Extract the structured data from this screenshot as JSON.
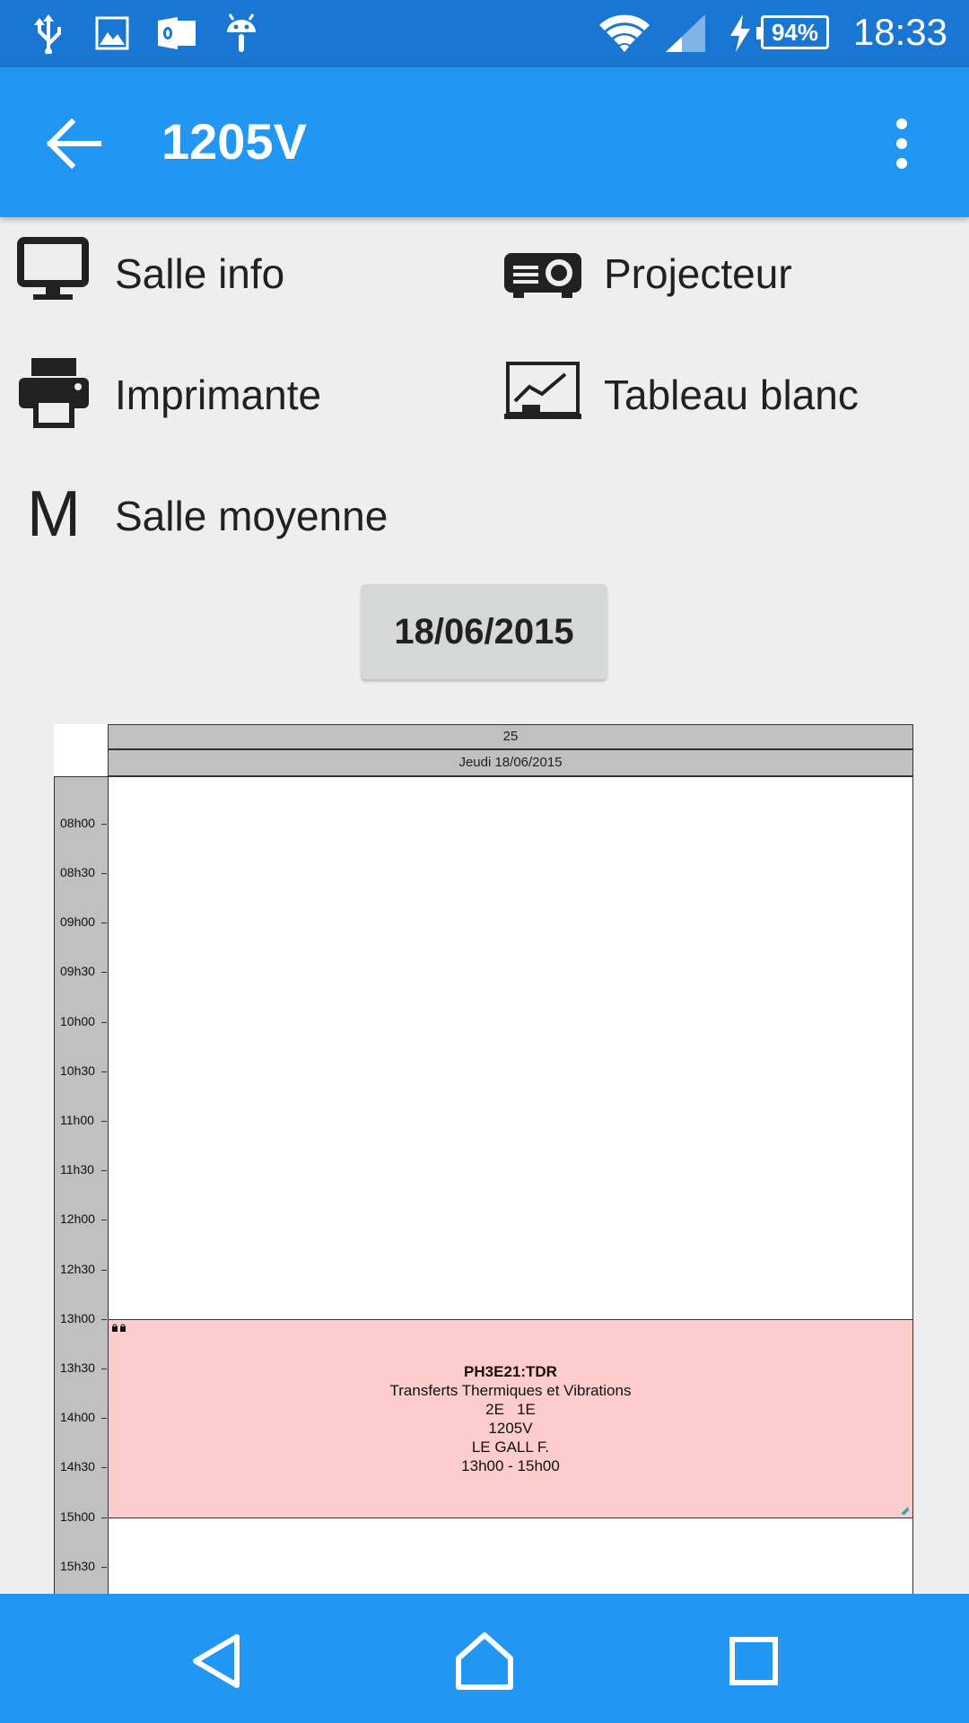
{
  "status_bar": {
    "icons": [
      "usb-icon",
      "image-icon",
      "outlook-icon",
      "android-icon",
      "wifi-icon",
      "signal-icon",
      "charging-icon"
    ],
    "battery": "94%",
    "time": "18:33"
  },
  "app_bar": {
    "title": "1205V",
    "back_icon": "arrow-back-icon",
    "menu_icon": "more-vert-icon"
  },
  "features": [
    {
      "label": "Salle info",
      "icon": "monitor-icon"
    },
    {
      "label": "Projecteur",
      "icon": "projector-icon"
    },
    {
      "label": "Imprimante",
      "icon": "printer-icon"
    },
    {
      "label": "Tableau blanc",
      "icon": "whiteboard-icon"
    },
    {
      "label": "Salle moyenne",
      "icon": "letter-m-icon",
      "letter": "M"
    }
  ],
  "date_button": "18/06/2015",
  "timetable": {
    "week": "25",
    "day": "Jeudi 18/06/2015",
    "times": [
      "08h00",
      "08h30",
      "09h00",
      "09h30",
      "10h00",
      "10h30",
      "11h00",
      "11h30",
      "12h00",
      "12h30",
      "13h00",
      "13h30",
      "14h00",
      "14h30",
      "15h00",
      "15h30"
    ],
    "event": {
      "code": "PH3E21:TDR",
      "title": "Transferts Thermiques et Vibrations",
      "groups": "2E   1E",
      "room": "1205V",
      "teacher": "LE GALL F.",
      "hours": "13h00 - 15h00",
      "color": "#fdcccc"
    }
  },
  "nav_bar": {
    "buttons": [
      "back-nav-icon",
      "home-nav-icon",
      "recents-nav-icon"
    ]
  },
  "colors": {
    "status_bar": "#1976d2",
    "app_bar": "#2196f3",
    "background": "#eeeeee"
  }
}
